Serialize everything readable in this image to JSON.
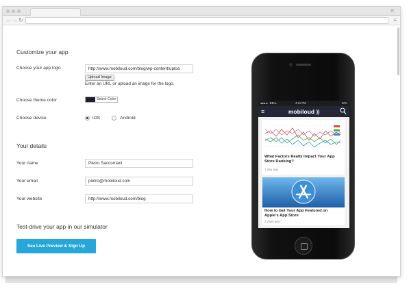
{
  "form": {
    "heading": "Customize your app",
    "logo_label": "Choose your app logo",
    "logo_url": "http://www.mobiloud.com/blog/wp-content/uploa",
    "upload_button": "Upload Image",
    "logo_hint": "Enter an URL or upload an image for the logo.",
    "theme_label": "Choose theme color",
    "theme_button": "Select Color",
    "theme_color": "#1c1e2b",
    "device_label": "Choose device",
    "device_options": [
      {
        "label": "iOS",
        "selected": true
      },
      {
        "label": "Android",
        "selected": false
      }
    ]
  },
  "details": {
    "heading": "Your details",
    "name_label": "Your name",
    "name_value": "Pietro Saccomani",
    "email_label": "Your email",
    "email_value": "pietro@mobiloud.com",
    "website_label": "Your website",
    "website_value": "http://www.mobiloud.com/blog"
  },
  "simulator": {
    "heading": "Test-drive your app in our simulator",
    "cta_label": "See Live Preview & Sign Up"
  },
  "phone": {
    "status": {
      "carrier": "●●●●○ BELL",
      "time": "4:21 PM",
      "battery": "22%"
    },
    "app_logo": "mobiloud",
    "app_logo_mark": "))",
    "cards": [
      {
        "title": "What Factors Really Impact Your App Store Ranking?",
        "meta": "1 day ago"
      },
      {
        "title": "How to Get Your App Featured on Apple's App Store",
        "meta": "2 days ago"
      }
    ]
  },
  "colors": {
    "accent": "#27a7d9",
    "app_header": "#232634"
  },
  "icons": [
    "browser-back-icon",
    "browser-forward-icon",
    "browser-reload-icon",
    "browser-menu-icon",
    "window-close-icon",
    "hamburger-icon",
    "search-icon",
    "app-store-icon"
  ]
}
